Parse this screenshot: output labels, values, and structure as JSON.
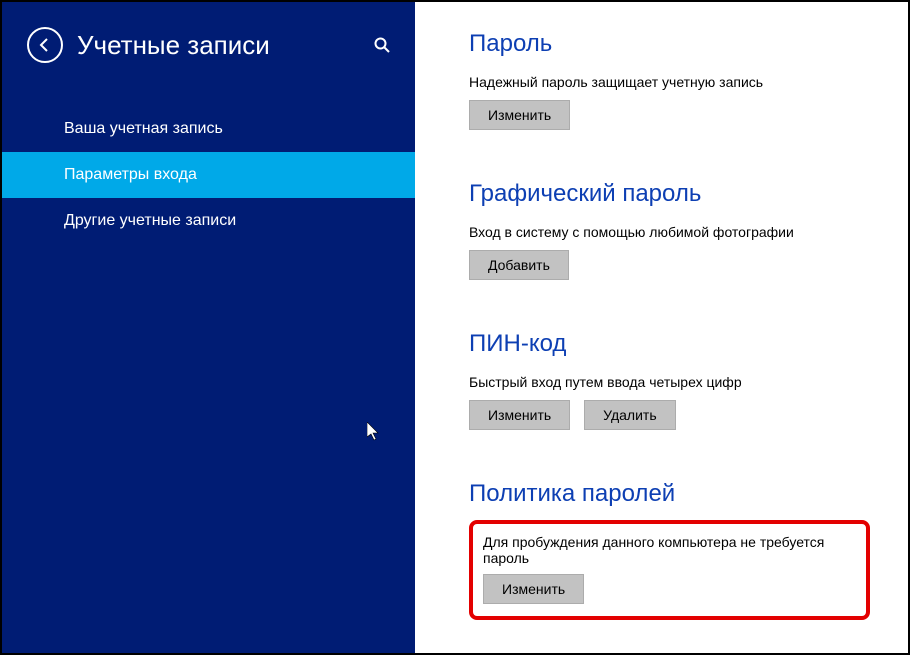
{
  "sidebar": {
    "title": "Учетные записи",
    "items": [
      {
        "label": "Ваша учетная запись",
        "active": false
      },
      {
        "label": "Параметры входа",
        "active": true
      },
      {
        "label": "Другие учетные записи",
        "active": false
      }
    ]
  },
  "sections": {
    "password": {
      "title": "Пароль",
      "desc": "Надежный пароль защищает учетную запись",
      "button": "Изменить"
    },
    "picture": {
      "title": "Графический пароль",
      "desc": "Вход в систему с помощью любимой фотографии",
      "button": "Добавить"
    },
    "pin": {
      "title": "ПИН-код",
      "desc": "Быстрый вход путем ввода четырех цифр",
      "button1": "Изменить",
      "button2": "Удалить"
    },
    "policy": {
      "title": "Политика паролей",
      "desc": "Для пробуждения данного компьютера не требуется пароль",
      "button": "Изменить"
    }
  }
}
